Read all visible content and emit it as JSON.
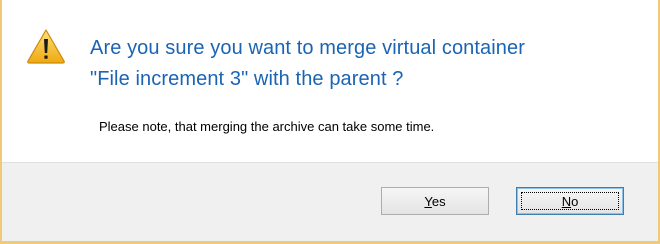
{
  "dialog": {
    "icon": "warning-icon",
    "main_instruction": "Are you sure you want to merge virtual container\n\"File increment 3\" with the parent ?",
    "note": "Please note, that merging the archive can take some time.",
    "buttons": {
      "yes": {
        "mnemonic": "Y",
        "rest": "es"
      },
      "no": {
        "mnemonic": "N",
        "rest": "o"
      }
    },
    "colors": {
      "instruction_text": "#1b64b4",
      "window_border": "#f0c97a",
      "footer_background": "#f0f0f0",
      "warning_fill": "#f7c52a"
    }
  }
}
